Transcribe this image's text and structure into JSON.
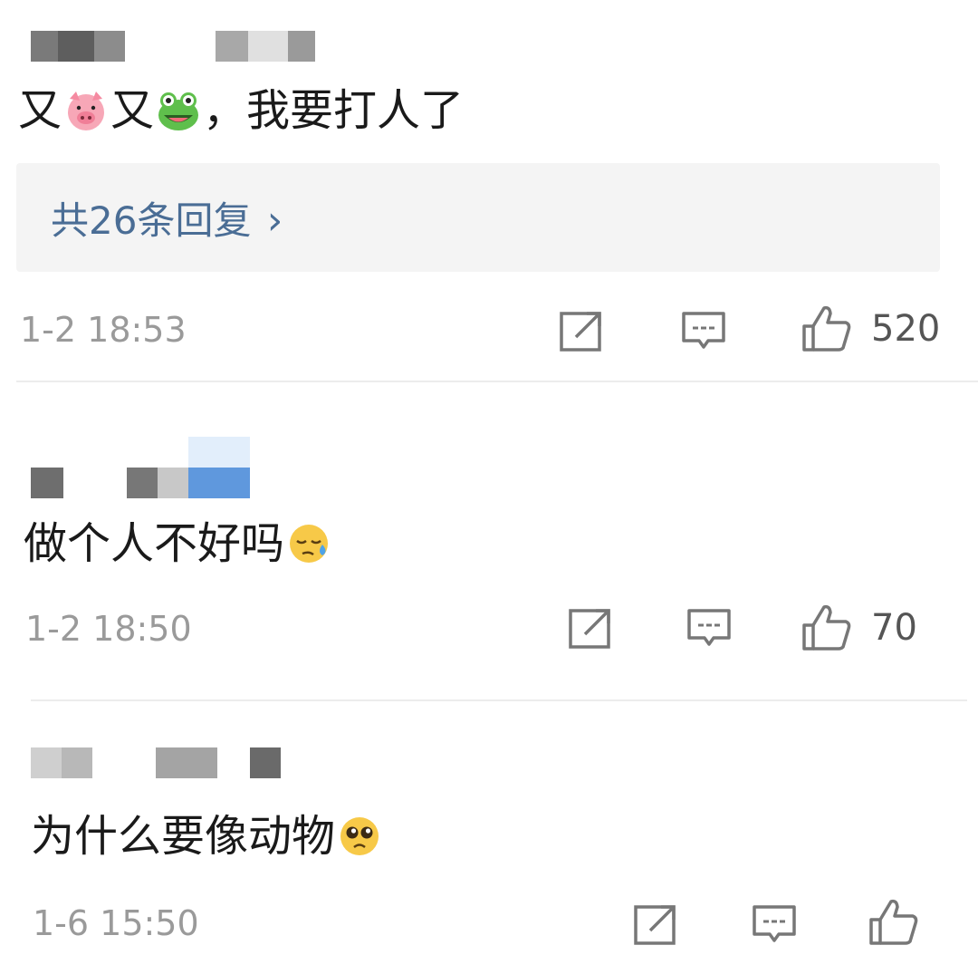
{
  "comments": [
    {
      "text": "又🐷又🐸，我要打人了",
      "text_parts": [
        "又",
        "又",
        "，我要打人了"
      ],
      "emojis": [
        "pig-face",
        "frog-face"
      ],
      "replies_label": "共26条回复 ",
      "replies_chevron": "›",
      "time": "1-2 18:53",
      "likes": "520"
    },
    {
      "text": "做个人不好吗😓",
      "text_parts": [
        "做个人不好吗"
      ],
      "emojis": [
        "downcast-sweat-face"
      ],
      "time": "1-2 18:50",
      "likes": "70"
    },
    {
      "text": "为什么要像动物🥺",
      "text_parts": [
        "为什么要像动物"
      ],
      "emojis": [
        "pleading-face"
      ],
      "time": "1-6 15:50",
      "likes": ""
    }
  ],
  "icons": {
    "share": "share-icon",
    "comment": "comment-icon",
    "like": "thumbs-up-icon"
  },
  "colors": {
    "link": "#4a6d95",
    "muted": "#9a9a9a",
    "replies_bg": "#f4f4f4"
  }
}
